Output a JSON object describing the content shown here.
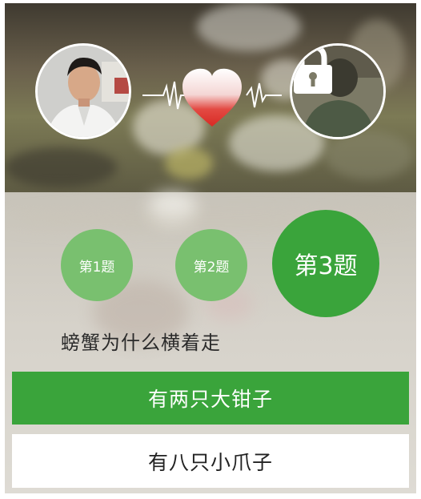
{
  "header": {
    "my_avatar": "user-avatar-photo",
    "partner_avatar": "locked-avatar-photo",
    "center_icon": "heart-heartbeat-icon",
    "lock_icon": "padlock-icon"
  },
  "questions": {
    "items": [
      {
        "label": "第1题",
        "state": "done"
      },
      {
        "label": "第2题",
        "state": "done"
      },
      {
        "label": "第3题",
        "state": "current"
      }
    ],
    "current_text": "螃蟹为什么横着走"
  },
  "answers": [
    {
      "label": "有两只大钳子",
      "selected": true
    },
    {
      "label": "有八只小爪子",
      "selected": false
    }
  ],
  "colors": {
    "accent": "#3aa43b",
    "accent_light": "#79c06f",
    "heart_top": "#e53935",
    "white": "#ffffff"
  }
}
